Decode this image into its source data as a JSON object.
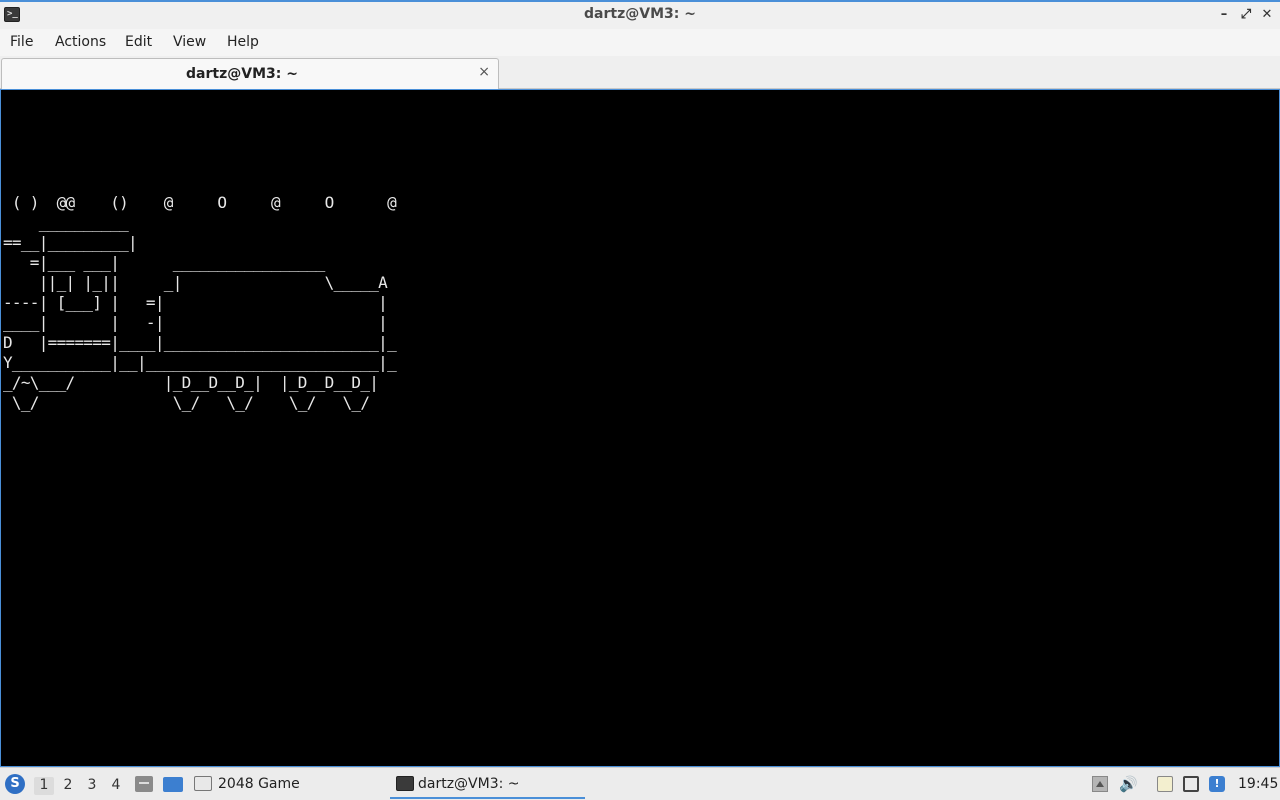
{
  "window": {
    "title": "dartz@VM3: ~",
    "app_icon_glyph": ">_",
    "buttons": {
      "minimize": "–",
      "maximize": "⤢",
      "close": "✕"
    }
  },
  "menu": {
    "items": [
      {
        "label": "File"
      },
      {
        "label": "Actions"
      },
      {
        "label": "Edit"
      },
      {
        "label": "View"
      },
      {
        "label": "Help"
      }
    ]
  },
  "tabs": [
    {
      "label": "dartz@VM3: ~",
      "close": "×",
      "active": true
    }
  ],
  "terminal": {
    "lines": [
      " ( )  @@    ()    @     O     @     O      @",
      "",
      "",
      "",
      "",
      "",
      "    __________",
      "==__|_________|",
      "   =|___ ___|      _________________",
      "    ||_| |_||     _|                \\_____A",
      "----| [___] |   =|                        |",
      "____|       |   -|                        |",
      "D   |=======|____|________________________|_",
      "Y___________|__|__________________________|_",
      "_/~\\___/          |_D__D__D_|  |_D__D__D_|",
      " \\_/               \\_/   \\_/    \\_/   \\_/"
    ]
  },
  "taskbar": {
    "start_glyph": "S",
    "workspaces": [
      {
        "label": "1",
        "active": true
      },
      {
        "label": "2",
        "active": false
      },
      {
        "label": "3",
        "active": false
      },
      {
        "label": "4",
        "active": false
      }
    ],
    "tasks": [
      {
        "label": "2048 Game"
      },
      {
        "label": "dartz@VM3: ~"
      }
    ],
    "volume_glyph": "🔊",
    "update_glyph": "!",
    "clock": "19:45"
  }
}
